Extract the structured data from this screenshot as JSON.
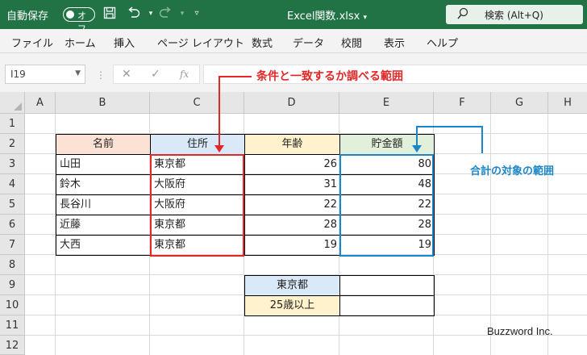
{
  "titlebar": {
    "autosave_label": "自動保存",
    "autosave_state": "オフ",
    "filename": "Excel関数.xlsx",
    "search_placeholder": "検索 (Alt+Q)",
    "icons": [
      "save-icon",
      "undo-icon",
      "redo-icon",
      "customize-qat-icon",
      "chevron-down-icon",
      "search-icon"
    ]
  },
  "ribbon": {
    "tabs": [
      "ファイル",
      "ホーム",
      "挿入",
      "ページ レイアウト",
      "数式",
      "データ",
      "校閲",
      "表示",
      "ヘルプ"
    ]
  },
  "formula_bar": {
    "name_box": "I19",
    "formula": "",
    "icons": [
      "cancel-icon",
      "enter-icon",
      "fx-icon"
    ]
  },
  "grid": {
    "columns": [
      "A",
      "B",
      "C",
      "D",
      "E",
      "F",
      "G",
      "H"
    ],
    "rows": [
      "1",
      "2",
      "3",
      "4",
      "5",
      "6",
      "7",
      "8",
      "9",
      "10",
      "11",
      "12"
    ],
    "headers": {
      "name": "名前",
      "address": "住所",
      "age": "年齢",
      "savings": "貯金額"
    },
    "records": [
      {
        "name": "山田",
        "address": "東京都",
        "age": "26",
        "savings": "80"
      },
      {
        "name": "鈴木",
        "address": "大阪府",
        "age": "31",
        "savings": "48"
      },
      {
        "name": "長谷川",
        "address": "大阪府",
        "age": "22",
        "savings": "22"
      },
      {
        "name": "近藤",
        "address": "東京都",
        "age": "28",
        "savings": "28"
      },
      {
        "name": "大西",
        "address": "東京都",
        "age": "19",
        "savings": "19"
      }
    ],
    "criteria": [
      {
        "label": "東京都",
        "result": ""
      },
      {
        "label": "25歳以上",
        "result": ""
      }
    ]
  },
  "annotations": {
    "criteria_range": "条件と一致するか調べる範囲",
    "sum_range": "合計の対象の範囲",
    "criteria_range_color": "#e32626",
    "sum_range_color": "#1b86c7"
  },
  "watermark": "Buzzword Inc.",
  "colors": {
    "titlebar": "#217346",
    "header_name": "#fbe2d5",
    "header_address": "#dae9f8",
    "header_age": "#fff2cc",
    "header_savings": "#e2efda"
  }
}
